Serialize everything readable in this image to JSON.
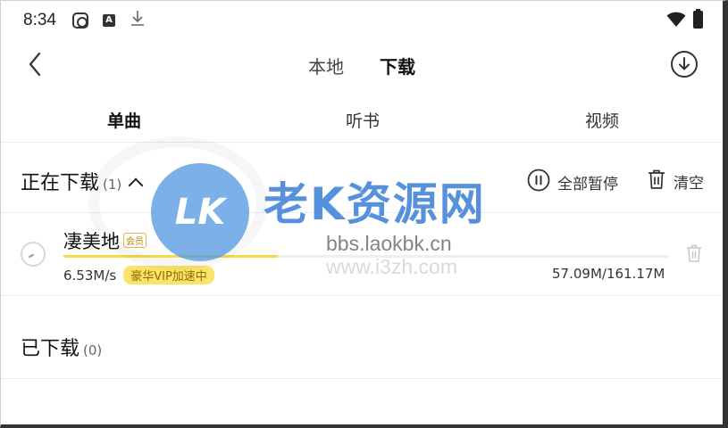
{
  "status_bar": {
    "time": "8:34",
    "icons": [
      "app-icon",
      "a-icon",
      "download-arrow-icon",
      "wifi-icon",
      "battery-icon"
    ]
  },
  "header": {
    "tabs": [
      {
        "label": "本地",
        "active": false
      },
      {
        "label": "下载",
        "active": true
      }
    ],
    "icons": [
      "back-icon",
      "download-circle-icon"
    ]
  },
  "sub_tabs": [
    {
      "label": "单曲",
      "active": true
    },
    {
      "label": "听书",
      "active": false
    },
    {
      "label": "视频",
      "active": false
    }
  ],
  "downloading": {
    "title": "正在下载",
    "count": "(1)",
    "pause_all_label": "全部暂停",
    "clear_label": "清空"
  },
  "download_item": {
    "name": "凄美地",
    "badge": "会员",
    "speed": "6.53M/s",
    "speedup_label": "豪华VIP加速中",
    "size": "57.09M/161.17M",
    "progress_fraction": 0.354
  },
  "downloaded": {
    "title": "已下载",
    "count": "(0)"
  },
  "watermark": {
    "logo": "LK",
    "title": "老K资源网",
    "url1": "bbs.laokbk.cn",
    "url2": "www.i3zh.com"
  },
  "colors": {
    "accent": "#f5d94a",
    "watermark_blue": "#4082d7"
  }
}
